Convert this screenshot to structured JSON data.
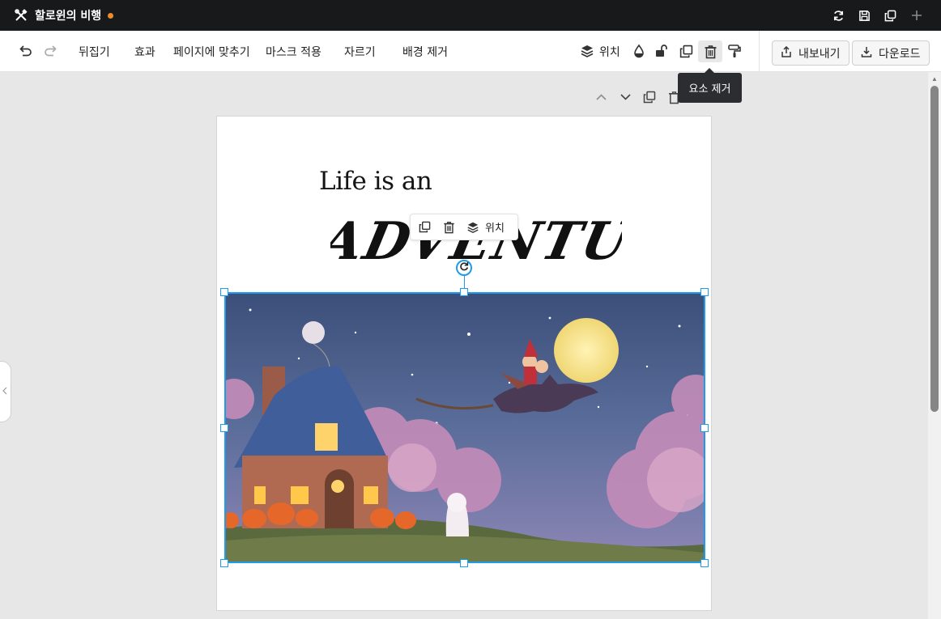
{
  "titlebar": {
    "title": "할로윈의 비행",
    "unsaved_color": "#f08b2c",
    "icons": [
      "tools-icon",
      "sync-icon",
      "save-icon",
      "duplicate-window-icon",
      "plus-icon"
    ]
  },
  "toolbar": {
    "undo_icon": "undo-icon",
    "redo_icon": "redo-icon",
    "flip": "뒤집기",
    "effects": "효과",
    "fit_page": "페이지에 맞추기",
    "apply_mask": "마스크 적용",
    "crop": "자르기",
    "remove_bg": "배경 제거",
    "position": "위치",
    "export": "내보내기",
    "download": "다운로드"
  },
  "tooltip": {
    "text": "요소 제거"
  },
  "canvas": {
    "line1": "Life is an",
    "line2": "ADVENTURE",
    "mini_toolbar": {
      "position": "위치"
    }
  },
  "colors": {
    "selection": "#1e9be9",
    "titlebar_bg": "#18191b",
    "canvas_bg": "#e7e7e7"
  }
}
